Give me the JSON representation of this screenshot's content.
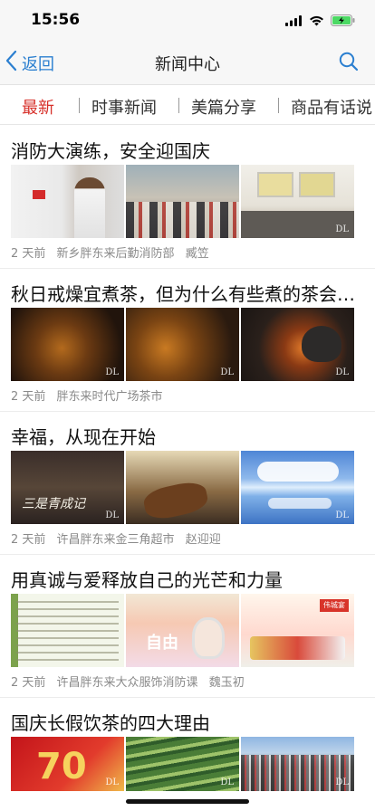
{
  "status_bar": {
    "time": "15:56"
  },
  "nav": {
    "back_label": "返回",
    "title": "新闻中心"
  },
  "tabs": [
    {
      "label": "最新",
      "active": true
    },
    {
      "label": "时事新闻",
      "active": false
    },
    {
      "label": "美篇分享",
      "active": false
    },
    {
      "label": "商品有话说",
      "active": false
    }
  ],
  "articles": [
    {
      "title": "消防大演练，安全迎国庆",
      "time": "2 天前",
      "source": "新乡胖东来后勤消防部",
      "author": "臧笠"
    },
    {
      "title": "秋日戒燥宜煮茶，但为什么有些煮的茶会苦涩？",
      "time": "2 天前",
      "source": "胖东来时代广场茶市",
      "author": ""
    },
    {
      "title": "幸福，从现在开始",
      "time": "2 天前",
      "source": "许昌胖东来金三角超市",
      "author": "赵迎迎"
    },
    {
      "title": "用真诚与爱释放自己的光芒和力量",
      "time": "2 天前",
      "source": "许昌胖东来大众服饰消防课",
      "author": "魏玉初"
    },
    {
      "title": "国庆长假饮茶的四大理由",
      "time": "",
      "source": "",
      "author": ""
    }
  ],
  "thumbnails": {
    "watermark": "DL",
    "movie_calligraphy": "三是青成记",
    "poster_text": "自由",
    "banner_tag": "伟城宴",
    "seventy": "70"
  },
  "icons": {
    "back": "chevron-left-icon",
    "search": "search-icon",
    "signal": "signal-icon",
    "wifi": "wifi-icon",
    "battery": "battery-charging-icon"
  },
  "colors": {
    "accent": "#2b7fd0",
    "active_tab": "#d7312b",
    "battery": "#4cd964"
  }
}
